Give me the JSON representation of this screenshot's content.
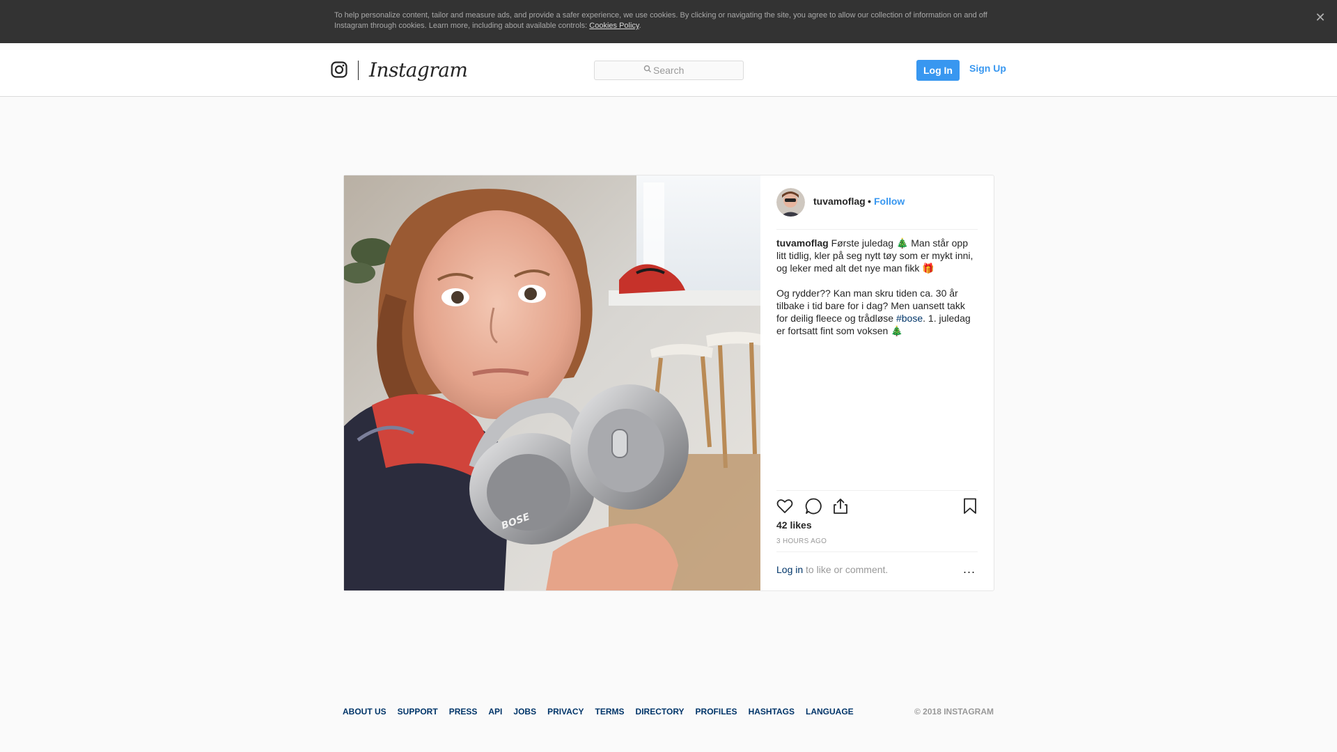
{
  "cookie_banner": {
    "text": "To help personalize content, tailor and measure ads, and provide a safer experience, we use cookies. By clicking or navigating the site, you agree to allow our collection of information on and off Instagram through cookies. Learn more, including about available controls: ",
    "link_label": "Cookies Policy",
    "trailing": ".",
    "close_icon": "close-icon"
  },
  "header": {
    "brand": "Instagram",
    "logo_icon": "instagram-camera-icon",
    "search": {
      "placeholder": "Search",
      "value": "",
      "icon": "search-icon"
    },
    "login_label": "Log In",
    "signup_label": "Sign Up",
    "accent_color": "#3897f0"
  },
  "post": {
    "username": "tuvamoflag",
    "separator": "•",
    "follow_label": "Follow",
    "caption_part1": "Første juledag 🎄 Man står opp litt tidlig, kler på seg nytt tøy som er mykt inni, og leker med alt det nye man fikk 🎁",
    "caption_part2": "Og rydder?? Kan man skru tiden ca. 30 år tilbake i tid bare for i dag? Men uansett takk for deilig fleece og trådløse ",
    "hashtag": "#bose",
    "caption_part3": ". 1. juledag er fortsatt fint som voksen 🎄",
    "likes": "42 likes",
    "time_ago": "3 HOURS AGO",
    "login_link": "Log in",
    "login_suffix": " to like or comment.",
    "more_label": "...",
    "action_icons": [
      "heart-icon",
      "comment-icon",
      "share-icon",
      "bookmark-icon"
    ]
  },
  "footer": {
    "links": [
      "ABOUT US",
      "SUPPORT",
      "PRESS",
      "API",
      "JOBS",
      "PRIVACY",
      "TERMS",
      "DIRECTORY",
      "PROFILES",
      "HASHTAGS",
      "LANGUAGE"
    ],
    "copyright": "© 2018 INSTAGRAM"
  }
}
